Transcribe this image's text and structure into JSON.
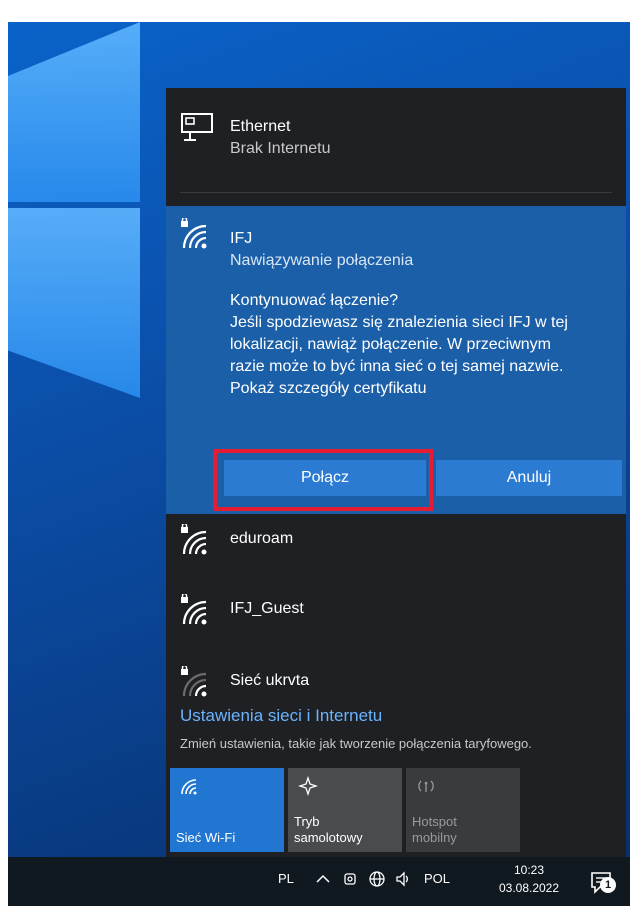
{
  "ethernet": {
    "title": "Ethernet",
    "status": "Brak Internetu"
  },
  "active_network": {
    "name": "IFJ",
    "status": "Nawiązywanie połączenia",
    "prompt_lines": [
      "Kontynuować łączenie?",
      "Jeśli spodziewasz się znalezienia sieci IFJ w tej",
      "lokalizacji, nawiąż połączenie. W przeciwnym",
      "razie może to być inna sieć o tej samej nazwie.",
      "Pokaż szczegóły certyfikatu"
    ],
    "connect_label": "Połącz",
    "cancel_label": "Anuluj"
  },
  "networks": [
    {
      "name": "eduroam",
      "icon": "wifi-secured-icon"
    },
    {
      "name": "IFJ_Guest",
      "icon": "wifi-secured-icon"
    },
    {
      "name": "Sieć ukrvta",
      "icon": "wifi-secured-weak-icon"
    }
  ],
  "settings": {
    "link": "Ustawienia sieci i Internetu",
    "description": "Zmień ustawienia, takie jak tworzenie połączenia taryfowego."
  },
  "quick_actions": [
    {
      "label": "Sieć Wi-Fi",
      "state": "on",
      "icon": "wifi-icon"
    },
    {
      "label": "Tryb samolotowy",
      "state": "off",
      "icon": "airplane-icon"
    },
    {
      "label": "Hotspot mobilny",
      "state": "disabled",
      "icon": "hotspot-icon"
    }
  ],
  "taskbar": {
    "input_lang_short": "PL",
    "keyboard_layout": "POL",
    "time": "10:23",
    "date": "03.08.2022",
    "notification_count": "1"
  },
  "colors": {
    "flyout_bg": "#1f2023",
    "active_network_bg": "#1b5fa8",
    "button_bg": "#2c7bd2",
    "accent_tile": "#2176d2",
    "link": "#6ab3ff",
    "highlight_border": "#e41d33",
    "taskbar_bg": "#101820"
  }
}
